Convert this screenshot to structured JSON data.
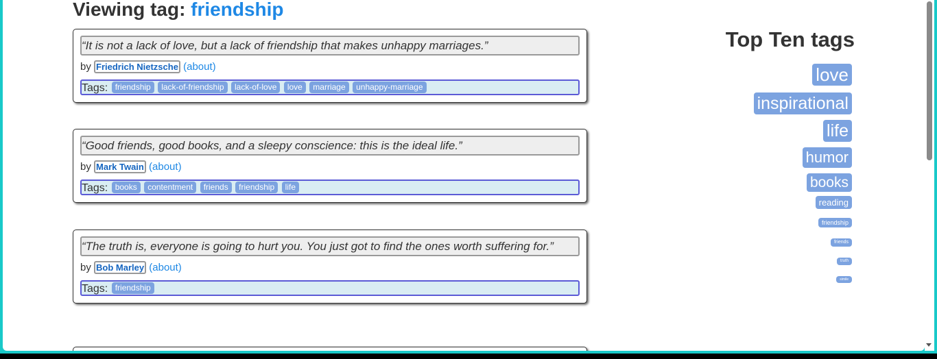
{
  "heading": {
    "prefix": "Viewing tag:",
    "tag": "friendship"
  },
  "quotes": [
    {
      "text": "“It is not a lack of love, but a lack of friendship that makes unhappy marriages.”",
      "by": "by",
      "author": "Friedrich Nietzsche",
      "about": "(about)",
      "tags_label": "Tags:",
      "tags": [
        "friendship",
        "lack-of-friendship",
        "lack-of-love",
        "love",
        "marriage",
        "unhappy-marriage"
      ]
    },
    {
      "text": "“Good friends, good books, and a sleepy conscience: this is the ideal life.”",
      "by": "by",
      "author": "Mark Twain",
      "about": "(about)",
      "tags_label": "Tags:",
      "tags": [
        "books",
        "contentment",
        "friends",
        "friendship",
        "life"
      ]
    },
    {
      "text": "“The truth is, everyone is going to hurt you. You just got to find the ones worth suffering for.”",
      "by": "by",
      "author": "Bob Marley",
      "about": "(about)",
      "tags_label": "Tags:",
      "tags": [
        "friendship"
      ]
    }
  ],
  "sidebar": {
    "title": "Top Ten tags",
    "tags": [
      "love",
      "inspirational",
      "life",
      "humor",
      "books",
      "reading",
      "friendship",
      "friends",
      "truth",
      "simile"
    ]
  },
  "colors": {
    "tag_chip": "#7ca3e0",
    "link": "#1e88e5",
    "tags_bg": "#d9edf3",
    "window_border": "#19c9c9"
  }
}
